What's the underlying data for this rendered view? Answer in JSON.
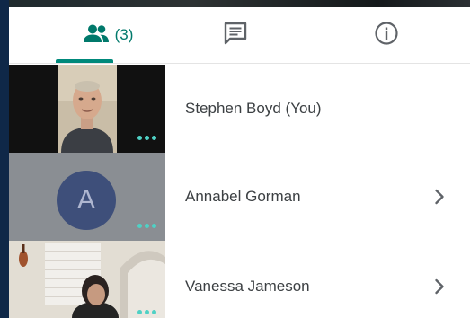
{
  "tabs": {
    "people_count": "(3)",
    "accent_color": "#00897b"
  },
  "participants": [
    {
      "name": "Stephen Boyd (You)",
      "has_chevron": false,
      "tile": "video"
    },
    {
      "name": "Annabel Gorman",
      "has_chevron": true,
      "tile": "avatar",
      "avatar_letter": "A"
    },
    {
      "name": "Vanessa Jameson",
      "has_chevron": true,
      "tile": "video"
    }
  ],
  "icons": {
    "people_tab": "people-icon",
    "chat_tab": "chat-icon",
    "info_tab": "info-icon",
    "more_options": "more-dots-icon",
    "chevron": "chevron-right-icon"
  }
}
